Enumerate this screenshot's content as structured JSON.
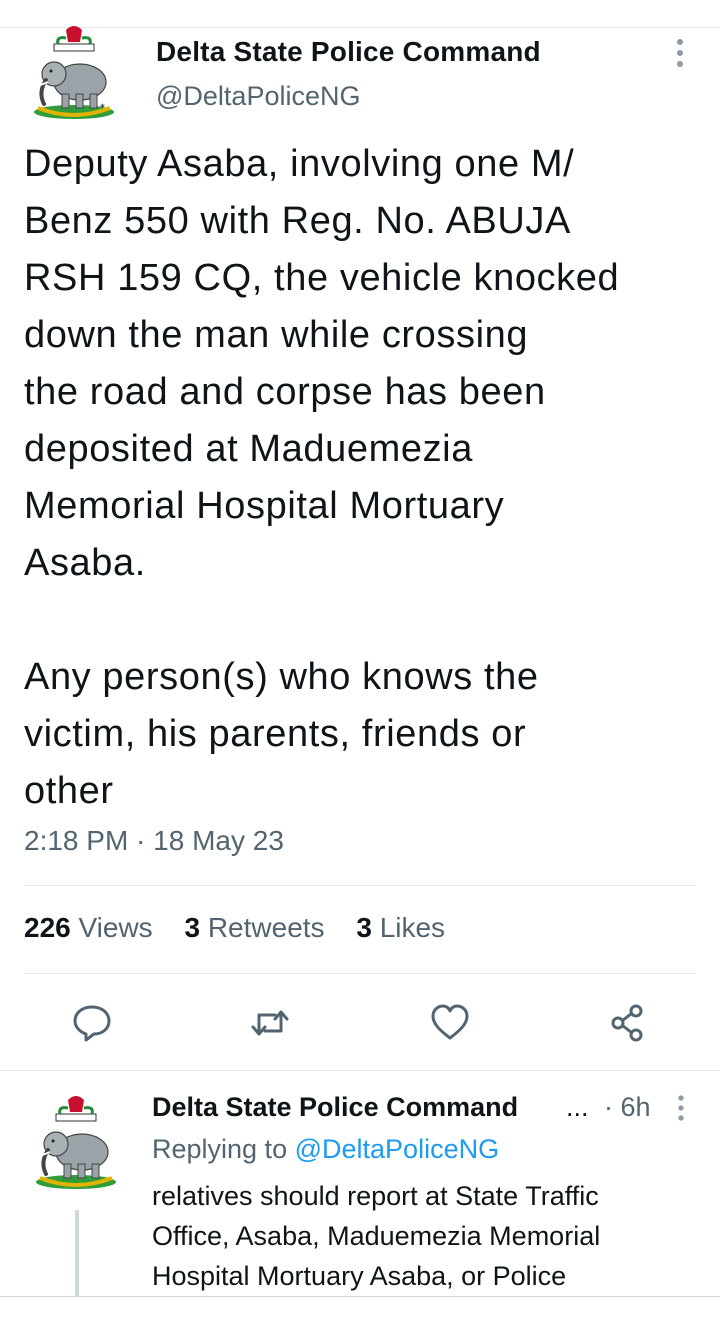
{
  "tweet": {
    "author_name": "Delta State Police Command",
    "author_handle": "@DeltaPoliceNG",
    "body_lines": [
      "Deputy Asaba, involving one M/",
      "Benz 550 with Reg. No. ABUJA",
      "RSH 159 CQ, the vehicle  knocked",
      "down the man while crossing",
      "the road and corpse has been",
      "deposited at Maduemezia",
      "Memorial Hospital Mortuary",
      "Asaba.",
      "",
      "Any person(s) who knows the",
      "victim, his parents, friends or",
      "other"
    ],
    "timestamp": "2:18 PM · 18 May 23",
    "views_count": "226",
    "views_label": "Views",
    "retweets_count": "3",
    "retweets_label": "Retweets",
    "likes_count": "3",
    "likes_label": "Likes",
    "actions": [
      "reply-icon",
      "retweet-icon",
      "like-icon",
      "share-icon"
    ]
  },
  "reply": {
    "author_name": "Delta State Police Command",
    "ellipsis": "...",
    "time": "· 6h",
    "replying_prefix": "Replying to",
    "replying_handle": "@DeltaPoliceNG",
    "body_lines": [
      "relatives should report at State Traffic",
      "Office, Asaba, Maduemezia Memorial",
      "Hospital Mortuary Asaba, or Police"
    ]
  },
  "colors": {
    "text": "#0f1419",
    "secondary": "#536471",
    "link": "#1d9bf0",
    "divider": "#e1e6ea"
  }
}
